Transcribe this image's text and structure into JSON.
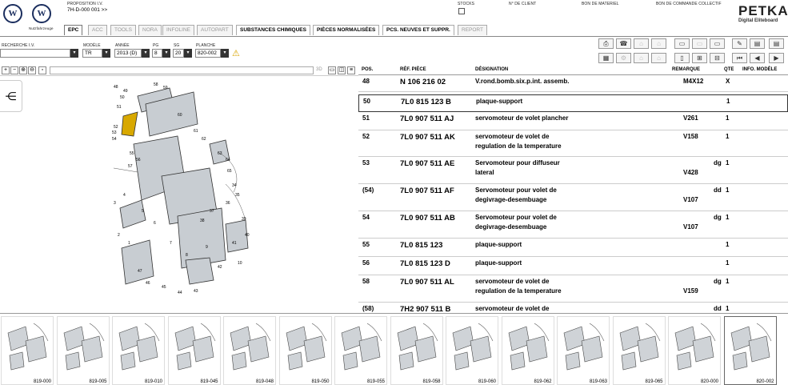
{
  "header": {
    "proposition_label": "PROPOSITION I.V.",
    "proposition_value": "7H-D-000 001 >>",
    "stocks_label": "STOCKS",
    "client_label": "N° DE CLIENT",
    "materiel_label": "BON DE MATERIEL",
    "commande_label": "BON DE COMMANDE COLLECTIF",
    "brand": "PETKA",
    "brand_sub": "Digital Eliteboard",
    "logo_caption": "Nutzfahrzeuge"
  },
  "tabs": [
    "EPC",
    "ACC",
    "TOOLS",
    "NORA",
    "INFOLINE",
    "AUTOPART",
    "SUBSTANCES CHIMIQUES",
    "PIÈCES NORMALISÉES",
    "PCS. NEUVES ET SUPPR.",
    "REPORT"
  ],
  "selectors": {
    "recherche_label": "RECHERCHE I.V.",
    "modele_label": "MODÈLE",
    "modele_value": "TR",
    "annee_label": "ANNÉE",
    "annee_value": "2013 (D)",
    "pg_label": "PG",
    "pg_value": "8",
    "sg_label": "SG",
    "sg_value": "20",
    "planche_label": "PLANCHE",
    "planche_value": "820-002"
  },
  "zoom_labels": [
    "3D"
  ],
  "table": {
    "headers": {
      "pos": "POS.",
      "ref": "RÉF. PIÈCE",
      "designation": "DÉSIGNATION",
      "remarque": "REMARQUE",
      "qte": "QTE",
      "info": "INFO. MODÈLE"
    },
    "rows": [
      {
        "pos": "48",
        "ref": "N   106 216 02",
        "des1": "V.rond.bomb.six.p.int. assemb.",
        "des2": "",
        "rem1": "M4X12",
        "rem2": "",
        "dg": "",
        "qty": "X"
      },
      {
        "pos": "50",
        "ref": "7L0 815 123 B",
        "des1": "plaque-support",
        "des2": "",
        "rem1": "",
        "rem2": "",
        "dg": "",
        "qty": "1"
      },
      {
        "pos": "51",
        "ref": "7L0 907 511 AJ",
        "des1": "servomoteur de volet plancher",
        "des2": "",
        "rem1": "V261",
        "rem2": "",
        "dg": "",
        "qty": "1"
      },
      {
        "pos": "52",
        "ref": "7L0 907 511 AK",
        "des1": "servomoteur de volet de",
        "des2": "regulation de la temperature",
        "rem1": "V158",
        "rem2": "",
        "dg": "",
        "qty": "1"
      },
      {
        "pos": "53",
        "ref": "7L0 907 511 AE",
        "des1": "Servomoteur pour diffuseur",
        "des2": "lateral",
        "rem1": "",
        "rem2": "V428",
        "dg": "dg",
        "qty": "1"
      },
      {
        "pos": "(54)",
        "ref": "7L0 907 511 AF",
        "des1": "Servomoteur pour volet de",
        "des2": "degivrage-desembuage",
        "rem1": "",
        "rem2": "V107",
        "dg": "dd",
        "qty": "1"
      },
      {
        "pos": "54",
        "ref": "7L0 907 511 AB",
        "des1": "Servomoteur pour volet de",
        "des2": "degivrage-desembuage",
        "rem1": "",
        "rem2": "V107",
        "dg": "dg",
        "qty": "1"
      },
      {
        "pos": "55",
        "ref": "7L0 815 123",
        "des1": "plaque-support",
        "des2": "",
        "rem1": "",
        "rem2": "",
        "dg": "",
        "qty": "1"
      },
      {
        "pos": "56",
        "ref": "7L0 815 123 D",
        "des1": "plaque-support",
        "des2": "",
        "rem1": "",
        "rem2": "",
        "dg": "",
        "qty": "1"
      },
      {
        "pos": "58",
        "ref": "7L0 907 511 AL",
        "des1": "servomoteur de volet de",
        "des2": "regulation de la temperature",
        "rem1": "",
        "rem2": "V159",
        "dg": "dg",
        "qty": "1"
      },
      {
        "pos": "(58)",
        "ref": "7H2 907 511 B",
        "des1": "servomoteur de volet de",
        "des2": "",
        "rem1": "",
        "rem2": "",
        "dg": "dd",
        "qty": "1"
      }
    ]
  },
  "thumbnails": [
    "819-000",
    "819-005",
    "819-010",
    "819-045",
    "819-048",
    "819-050",
    "819-055",
    "819-058",
    "819-060",
    "819-062",
    "819-063",
    "819-065",
    "820-000",
    "820-002"
  ],
  "callouts": [
    "48",
    "49",
    "50",
    "51",
    "52",
    "53",
    "54",
    "55",
    "56",
    "57",
    "58",
    "59",
    "60",
    "61",
    "62",
    "63",
    "64",
    "65",
    "34",
    "35",
    "36",
    "37",
    "38",
    "39",
    "40",
    "41",
    "42",
    "43",
    "44",
    "45",
    "46",
    "47",
    "1",
    "2",
    "3",
    "4",
    "5",
    "6",
    "7",
    "8",
    "9",
    "10"
  ],
  "colors": {
    "highlight": "#d8a800",
    "border": "#888"
  }
}
